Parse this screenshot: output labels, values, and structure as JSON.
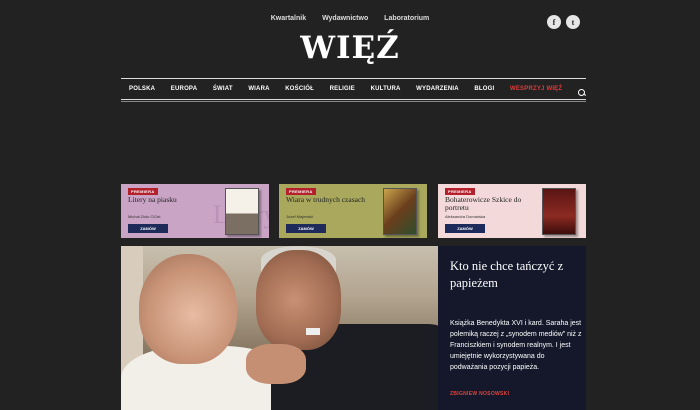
{
  "top_links": [
    "Kwartalnik",
    "Wydawnictwo",
    "Laboratorium"
  ],
  "social": [
    {
      "icon": "facebook-icon",
      "glyph": "f"
    },
    {
      "icon": "twitter-icon",
      "glyph": "t"
    }
  ],
  "logo": "WIĘŹ",
  "nav": {
    "items": [
      "POLSKA",
      "EUROPA",
      "ŚWIAT",
      "WIARA",
      "KOŚCIÓŁ",
      "RELIGIE",
      "KULTURA",
      "WYDARZENIA",
      "BLOGI"
    ],
    "support": "WESPRZYJ WIĘŹ",
    "support_color": "#e03a3a"
  },
  "ads": [
    {
      "badge": "PREMIERA",
      "title": "Litery na piasku",
      "author": "Michał Zioło OCist",
      "button": "ZAMÓW",
      "watermark": "Litery"
    },
    {
      "badge": "PREMIERA",
      "title": "Wiara w trudnych czasach",
      "author": "Józef Majewski",
      "button": "ZAMÓW"
    },
    {
      "badge": "PREMIERA",
      "title": "Bohaterowicze Szkice do portretu",
      "author": "Aleksandra Domańska",
      "button": "ZAMÓW"
    }
  ],
  "hero": {
    "headline": "Kto nie chce tańczyć z papieżem",
    "lead": "Książka Benedykta XVI i kard. Saraha jest polemiką raczej z „synodem mediów” niż z Franciszkiem i synodem realnym. I jest umiejętnie wykorzystywana do podważania pozycji papieża.",
    "byline": "ZBIGNIEW NOSOWSKI"
  }
}
